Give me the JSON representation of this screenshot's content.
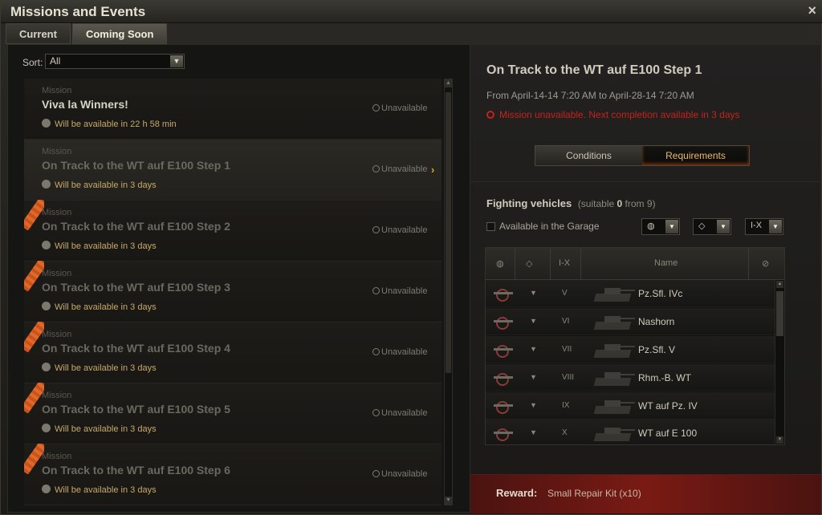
{
  "window": {
    "title": "Missions and Events",
    "close_icon": "×"
  },
  "tabs": [
    {
      "label": "Current",
      "active": false
    },
    {
      "label": "Coming Soon",
      "active": true
    }
  ],
  "sort": {
    "label": "Sort:",
    "value": "All"
  },
  "missions": [
    {
      "kind": "Mission",
      "name": "Viva la Winners!",
      "availability": "Will be available in 22 h 58 min",
      "status": "Unavailable",
      "selected": false,
      "ribbon": false
    },
    {
      "kind": "Mission",
      "name": "On Track to the WT auf E100 Step 1",
      "availability": "Will be available in 3 days",
      "status": "Unavailable",
      "selected": true,
      "ribbon": false
    },
    {
      "kind": "Mission",
      "name": "On Track to the WT auf E100 Step 2",
      "availability": "Will be available in 3 days",
      "status": "Unavailable",
      "selected": false,
      "ribbon": true
    },
    {
      "kind": "Mission",
      "name": "On Track to the WT auf E100 Step 3",
      "availability": "Will be available in 3 days",
      "status": "Unavailable",
      "selected": false,
      "ribbon": true
    },
    {
      "kind": "Mission",
      "name": "On Track to the WT auf E100 Step 4",
      "availability": "Will be available in 3 days",
      "status": "Unavailable",
      "selected": false,
      "ribbon": true
    },
    {
      "kind": "Mission",
      "name": "On Track to the WT auf E100 Step 5",
      "availability": "Will be available in 3 days",
      "status": "Unavailable",
      "selected": false,
      "ribbon": true
    },
    {
      "kind": "Mission",
      "name": "On Track to the WT auf E100 Step 6",
      "availability": "Will be available in 3 days",
      "status": "Unavailable",
      "selected": false,
      "ribbon": true
    }
  ],
  "detail": {
    "title": "On Track to the WT auf E100 Step 1",
    "dates": "From April-14-14 7:20 AM to April-28-14 7:20 AM",
    "warning": "Mission unavailable. Next completion available in 3 days",
    "toggle": {
      "conditions": "Conditions",
      "requirements": "Requirements",
      "active": "requirements"
    },
    "fighting": {
      "heading": "Fighting vehicles",
      "suitable_prefix": "(suitable",
      "suitable_count": "0",
      "suitable_mid": "from",
      "suitable_total": "9)",
      "garage_label": "Available in the Garage",
      "tier_filter": "I-X"
    },
    "table": {
      "headers": {
        "tier": "I-X",
        "name": "Name"
      },
      "rows": [
        {
          "tier": "V",
          "name": "Pz.Sfl. IVc"
        },
        {
          "tier": "VI",
          "name": "Nashorn"
        },
        {
          "tier": "VII",
          "name": "Pz.Sfl. V"
        },
        {
          "tier": "VIII",
          "name": "Rhm.-B. WT"
        },
        {
          "tier": "IX",
          "name": "WT auf Pz. IV"
        },
        {
          "tier": "X",
          "name": "WT auf E 100"
        }
      ]
    },
    "reward": {
      "label": "Reward:",
      "value": "Small Repair Kit (x10)"
    }
  }
}
